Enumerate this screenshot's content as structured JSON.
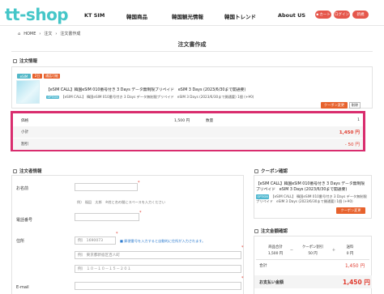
{
  "header": {
    "logo": "tt-shop",
    "nav": [
      "KT SIM",
      "韓国商品",
      "韓国観光情報",
      "韓国トレンド",
      "About US"
    ],
    "cart_label": "カート",
    "login_label": "ログイン",
    "register_label": "新規"
  },
  "breadcrumb": [
    "HOME",
    "注文",
    "注文書作成"
  ],
  "page_title": "注文書作成",
  "order_info": {
    "section_title": "注文情報",
    "tags": [
      "eSIM",
      "2日",
      "通話可能"
    ],
    "product_line1": "【eSIM CALL】韓国eSIM 010番号付き 3 Days データ無制限プリペイド　eSIM 3 Days (2023/6/30まで開通要)",
    "product_badge": "OPTION",
    "product_line2": "【eSIM CALL】 韓国eSIM 010番号付き 3 Days データ無制限プリペイド　eSIM 3 Days (2023/6/30まで開通要) 1個 (+¥0)",
    "coupon_button": "クーポン変更",
    "delete_button": "削除"
  },
  "summary": {
    "price_label": "価格",
    "price_value": "1,500 円",
    "qty_label": "数量",
    "qty_value": "1",
    "subtotal_label": "小計",
    "subtotal_value": "1,450 円",
    "discount_label": "割引",
    "discount_value": "- 50 円"
  },
  "orderer": {
    "section_title": "注文者情報",
    "name_label": "お名前",
    "name_hint": "例）  福田　太郎　※姓と名の間にスペースを入力ください",
    "phone_label": "電話番号",
    "address_label": "住所",
    "postal_placeholder": "例）  1690073",
    "address_note": "■ 郵便番号を入力すると自動的に住所が入力されます。",
    "address1_placeholder": "例）  東京都新宿区百人町",
    "address2_placeholder": "例）  １０－１０－１５－２０１",
    "email_label": "E-mail",
    "required_mark": "*"
  },
  "coupon_panel": {
    "section_title": "クーポン確認",
    "line1": "【eSIM CALL】韓国eSIM 010番号付き 3 Days データ無制限プリペイド　eSIM 3 Days (2023/6/30まで開通要)",
    "badge": "OPTION",
    "line2": "【eSIM CALL】 韓国eSIM 010番号付き 3 Days データ無制限プリペイド　eSIM 3 Days (2023/6/30まで開通要) 1個 (+¥0)",
    "button": "クーポン変更"
  },
  "amount_panel": {
    "section_title": "注文金額確認",
    "col_product": "商品合計",
    "col_coupon": "クーポン割引",
    "col_shipping": "送料",
    "product_total": "1,500 円",
    "coupon_discount": "50 円",
    "shipping": "0 円",
    "minus": "－",
    "plus": "＋",
    "total_label": "合計",
    "total_value": "1,450 円",
    "pay_label": "お支払い金額",
    "pay_value": "1,450 円"
  },
  "colors": {
    "brand": "#45c6c8",
    "accent": "#e7622d",
    "highlight_box": "#d92d6e",
    "price_red": "#e0392c"
  }
}
